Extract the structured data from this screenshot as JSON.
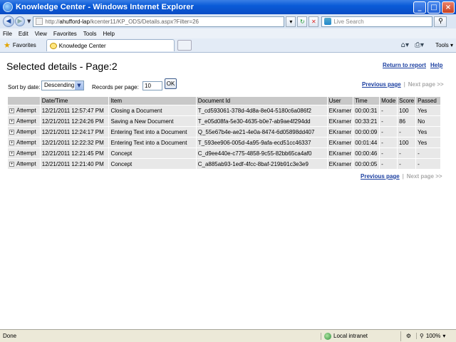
{
  "window": {
    "title": "Knowledge Center - Windows Internet Explorer"
  },
  "address": {
    "url_prefix": "http://",
    "url_host": "ahufford-lap",
    "url_path": "/kcenter11/KP_ODS/Details.aspx?Filter=26",
    "search_placeholder": "Live Search"
  },
  "menu": [
    "File",
    "Edit",
    "View",
    "Favorites",
    "Tools",
    "Help"
  ],
  "tabs": {
    "favorites_label": "Favorites",
    "active_tab": "Knowledge Center",
    "tools_label": "Tools"
  },
  "page": {
    "title": "Selected details  -  Page:2",
    "return_link": "Return to report",
    "help_link": "Help",
    "sort_label": "Sort by date:",
    "sort_value": "Descending",
    "rpp_label": "Records per page:",
    "rpp_value": "10",
    "ok_label": "OK",
    "prev_page": "Previous page",
    "separator": "|",
    "next_page": "Next page >>"
  },
  "table": {
    "headers": [
      "",
      "Date/Time",
      "Item",
      "Document Id",
      "User",
      "Time",
      "Mode",
      "Score",
      "Passed"
    ],
    "expander_symbol": "+",
    "rows": [
      {
        "type": "Attempt",
        "datetime": "12/21/2011 12:57:47 PM",
        "item": "Closing a Document",
        "doc_id": "T_cd593061-378d-4d8a-8e04-5180c6a086f2",
        "user": "EKramer",
        "time": "00:00:31",
        "mode": "-",
        "score": "100",
        "passed": "Yes"
      },
      {
        "type": "Attempt",
        "datetime": "12/21/2011 12:24:26 PM",
        "item": "Saving a New Document",
        "doc_id": "T_e05d08fa-5e30-4635-b0e7-ab9ae4f294dd",
        "user": "EKramer",
        "time": "00:33:21",
        "mode": "-",
        "score": "86",
        "passed": "No"
      },
      {
        "type": "Attempt",
        "datetime": "12/21/2011 12:24:17 PM",
        "item": "Entering Text into a Document",
        "doc_id": "Q_55e67b4e-ae21-4e0a-8474-6d05898dd407",
        "user": "EKramer",
        "time": "00:00:09",
        "mode": "-",
        "score": "-",
        "passed": "Yes"
      },
      {
        "type": "Attempt",
        "datetime": "12/21/2011 12:22:32 PM",
        "item": "Entering Text into a Document",
        "doc_id": "T_593ee906-005d-4a95-9afa-ecd51cc46337",
        "user": "EKramer",
        "time": "00:01:44",
        "mode": "-",
        "score": "100",
        "passed": "Yes"
      },
      {
        "type": "Attempt",
        "datetime": "12/21/2011 12:21:45 PM",
        "item": "Concept",
        "doc_id": "C_d9ee440e-c775-4858-9c55-82bb65ca4af0",
        "user": "EKramer",
        "time": "00:00:46",
        "mode": "-",
        "score": "-",
        "passed": "-"
      },
      {
        "type": "Attempt",
        "datetime": "12/21/2011 12:21:40 PM",
        "item": "Concept",
        "doc_id": "C_a885ab93-1edf-4fcc-8baf-219b91c3e3e9",
        "user": "EKramer",
        "time": "00:00:05",
        "mode": "-",
        "score": "-",
        "passed": "-"
      }
    ]
  },
  "status": {
    "text": "Done",
    "zone": "Local intranet",
    "zoom": "100%"
  },
  "icons": {
    "app": "ie-logo-icon",
    "back": "back-arrow-icon",
    "forward": "forward-arrow-icon",
    "refresh": "refresh-icon",
    "stop": "stop-icon",
    "search": "magnifier-icon"
  }
}
